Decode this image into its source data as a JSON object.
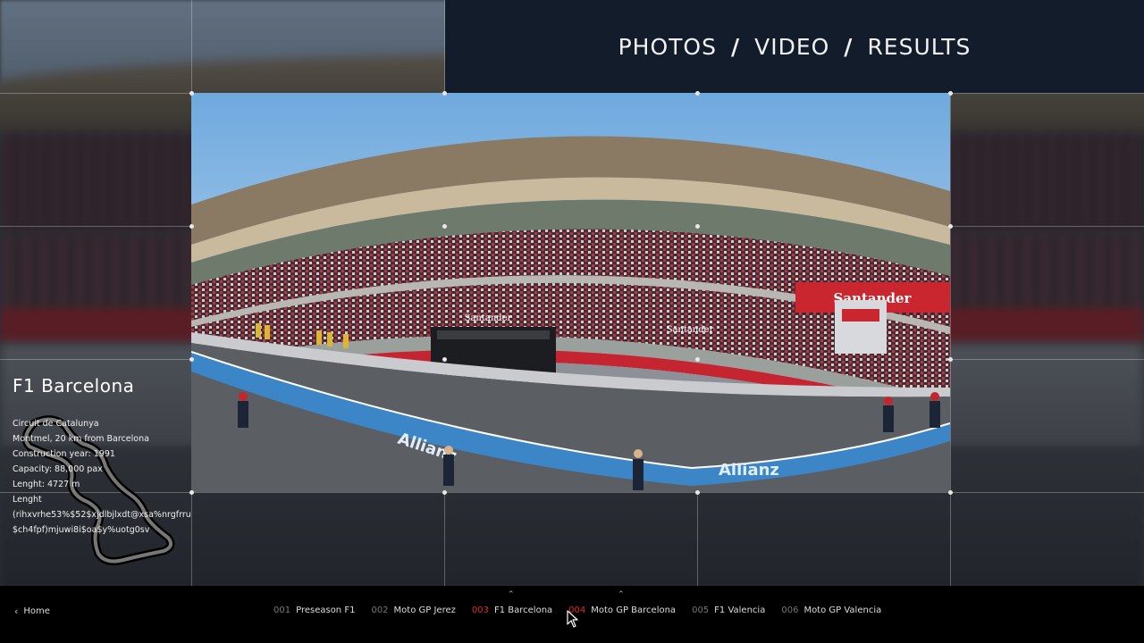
{
  "nav": {
    "photos": "PHOTOS",
    "video": "VIDEO",
    "results": "RESULTS",
    "separator": "/"
  },
  "info": {
    "title": "F1 Barcelona",
    "lines": [
      "Circuit de Catalunya",
      "Montmel, 20 km from Barcelona",
      "Construction year: 1991",
      "Capacity: 88,000 pax",
      "Lenght: 4727 m",
      "Lenght",
      "(rihxvrhe53%$52$xjdlbjlxdt@xsa%nrgfrru",
      "$ch4fpf)mjuwi8i$oa$y%uotg0sv"
    ]
  },
  "photo": {
    "sponsor_main": "Santander",
    "sponsor_track": "Allianz"
  },
  "footer": {
    "home": "Home",
    "items": [
      {
        "num": "001",
        "label": "Preseason F1"
      },
      {
        "num": "002",
        "label": "Moto GP Jerez"
      },
      {
        "num": "003",
        "label": "F1 Barcelona"
      },
      {
        "num": "004",
        "label": "Moto GP Barcelona"
      },
      {
        "num": "005",
        "label": "F1 Valencia"
      },
      {
        "num": "006",
        "label": "Moto GP Valencia"
      }
    ]
  },
  "colors": {
    "accent": "#e0282e",
    "header_bg": "#121c2b",
    "footer_bg": "#000000"
  }
}
